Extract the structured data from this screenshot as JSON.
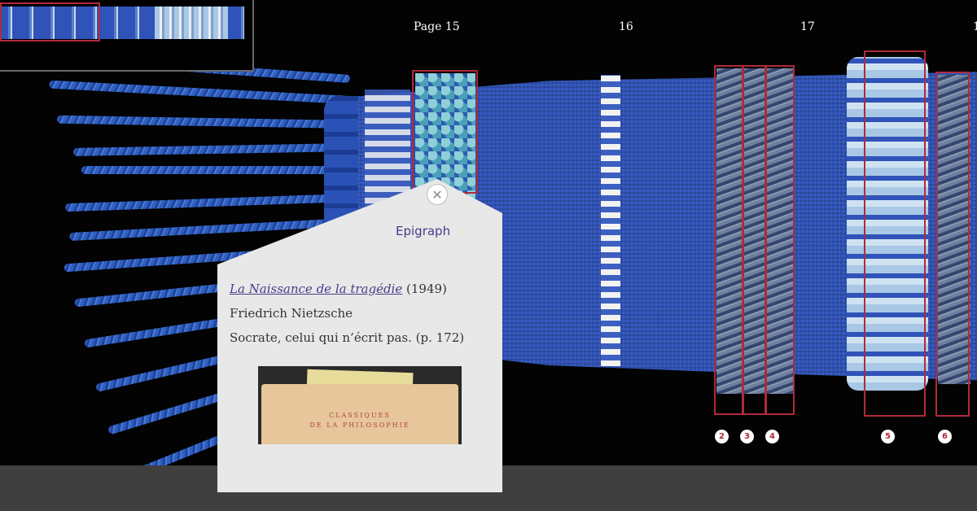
{
  "pages": [
    "Page 15",
    "16",
    "17",
    "1"
  ],
  "markers": [
    "2",
    "3",
    "4",
    "5",
    "6"
  ],
  "popup": {
    "category": "Epigraph",
    "book_title": "La Naissance de la tragédie",
    "year": "(1949)",
    "author": "Friedrich Nietzsche",
    "quote": "Socrate, celui qui n’écrit pas. (p. 172)",
    "cover_line1": "CLASSIQUES",
    "cover_line2": "DE LA PHILOSOPHIE",
    "close_icon": "close-icon"
  },
  "colors": {
    "accent": "#b02a3a",
    "link": "#4a3a8a",
    "popup_bg": "#e8e8e8",
    "bottom_bar": "#3f3f3f",
    "yarn_blue": "#2f53b8"
  }
}
